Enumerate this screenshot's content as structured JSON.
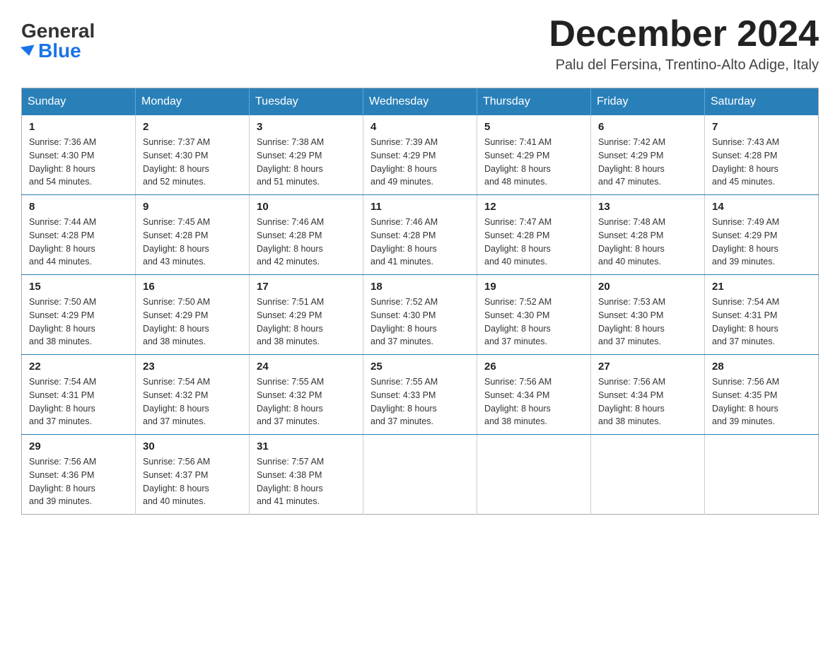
{
  "logo": {
    "general": "General",
    "blue": "Blue"
  },
  "title": {
    "month_year": "December 2024",
    "location": "Palu del Fersina, Trentino-Alto Adige, Italy"
  },
  "days_of_week": [
    "Sunday",
    "Monday",
    "Tuesday",
    "Wednesday",
    "Thursday",
    "Friday",
    "Saturday"
  ],
  "weeks": [
    [
      {
        "day": "1",
        "sunrise": "7:36 AM",
        "sunset": "4:30 PM",
        "daylight": "8 hours and 54 minutes."
      },
      {
        "day": "2",
        "sunrise": "7:37 AM",
        "sunset": "4:30 PM",
        "daylight": "8 hours and 52 minutes."
      },
      {
        "day": "3",
        "sunrise": "7:38 AM",
        "sunset": "4:29 PM",
        "daylight": "8 hours and 51 minutes."
      },
      {
        "day": "4",
        "sunrise": "7:39 AM",
        "sunset": "4:29 PM",
        "daylight": "8 hours and 49 minutes."
      },
      {
        "day": "5",
        "sunrise": "7:41 AM",
        "sunset": "4:29 PM",
        "daylight": "8 hours and 48 minutes."
      },
      {
        "day": "6",
        "sunrise": "7:42 AM",
        "sunset": "4:29 PM",
        "daylight": "8 hours and 47 minutes."
      },
      {
        "day": "7",
        "sunrise": "7:43 AM",
        "sunset": "4:28 PM",
        "daylight": "8 hours and 45 minutes."
      }
    ],
    [
      {
        "day": "8",
        "sunrise": "7:44 AM",
        "sunset": "4:28 PM",
        "daylight": "8 hours and 44 minutes."
      },
      {
        "day": "9",
        "sunrise": "7:45 AM",
        "sunset": "4:28 PM",
        "daylight": "8 hours and 43 minutes."
      },
      {
        "day": "10",
        "sunrise": "7:46 AM",
        "sunset": "4:28 PM",
        "daylight": "8 hours and 42 minutes."
      },
      {
        "day": "11",
        "sunrise": "7:46 AM",
        "sunset": "4:28 PM",
        "daylight": "8 hours and 41 minutes."
      },
      {
        "day": "12",
        "sunrise": "7:47 AM",
        "sunset": "4:28 PM",
        "daylight": "8 hours and 40 minutes."
      },
      {
        "day": "13",
        "sunrise": "7:48 AM",
        "sunset": "4:28 PM",
        "daylight": "8 hours and 40 minutes."
      },
      {
        "day": "14",
        "sunrise": "7:49 AM",
        "sunset": "4:29 PM",
        "daylight": "8 hours and 39 minutes."
      }
    ],
    [
      {
        "day": "15",
        "sunrise": "7:50 AM",
        "sunset": "4:29 PM",
        "daylight": "8 hours and 38 minutes."
      },
      {
        "day": "16",
        "sunrise": "7:50 AM",
        "sunset": "4:29 PM",
        "daylight": "8 hours and 38 minutes."
      },
      {
        "day": "17",
        "sunrise": "7:51 AM",
        "sunset": "4:29 PM",
        "daylight": "8 hours and 38 minutes."
      },
      {
        "day": "18",
        "sunrise": "7:52 AM",
        "sunset": "4:30 PM",
        "daylight": "8 hours and 37 minutes."
      },
      {
        "day": "19",
        "sunrise": "7:52 AM",
        "sunset": "4:30 PM",
        "daylight": "8 hours and 37 minutes."
      },
      {
        "day": "20",
        "sunrise": "7:53 AM",
        "sunset": "4:30 PM",
        "daylight": "8 hours and 37 minutes."
      },
      {
        "day": "21",
        "sunrise": "7:54 AM",
        "sunset": "4:31 PM",
        "daylight": "8 hours and 37 minutes."
      }
    ],
    [
      {
        "day": "22",
        "sunrise": "7:54 AM",
        "sunset": "4:31 PM",
        "daylight": "8 hours and 37 minutes."
      },
      {
        "day": "23",
        "sunrise": "7:54 AM",
        "sunset": "4:32 PM",
        "daylight": "8 hours and 37 minutes."
      },
      {
        "day": "24",
        "sunrise": "7:55 AM",
        "sunset": "4:32 PM",
        "daylight": "8 hours and 37 minutes."
      },
      {
        "day": "25",
        "sunrise": "7:55 AM",
        "sunset": "4:33 PM",
        "daylight": "8 hours and 37 minutes."
      },
      {
        "day": "26",
        "sunrise": "7:56 AM",
        "sunset": "4:34 PM",
        "daylight": "8 hours and 38 minutes."
      },
      {
        "day": "27",
        "sunrise": "7:56 AM",
        "sunset": "4:34 PM",
        "daylight": "8 hours and 38 minutes."
      },
      {
        "day": "28",
        "sunrise": "7:56 AM",
        "sunset": "4:35 PM",
        "daylight": "8 hours and 39 minutes."
      }
    ],
    [
      {
        "day": "29",
        "sunrise": "7:56 AM",
        "sunset": "4:36 PM",
        "daylight": "8 hours and 39 minutes."
      },
      {
        "day": "30",
        "sunrise": "7:56 AM",
        "sunset": "4:37 PM",
        "daylight": "8 hours and 40 minutes."
      },
      {
        "day": "31",
        "sunrise": "7:57 AM",
        "sunset": "4:38 PM",
        "daylight": "8 hours and 41 minutes."
      },
      null,
      null,
      null,
      null
    ]
  ],
  "labels": {
    "sunrise": "Sunrise:",
    "sunset": "Sunset:",
    "daylight": "Daylight:"
  },
  "colors": {
    "header_bg": "#2980b9",
    "border": "#2980b9"
  }
}
